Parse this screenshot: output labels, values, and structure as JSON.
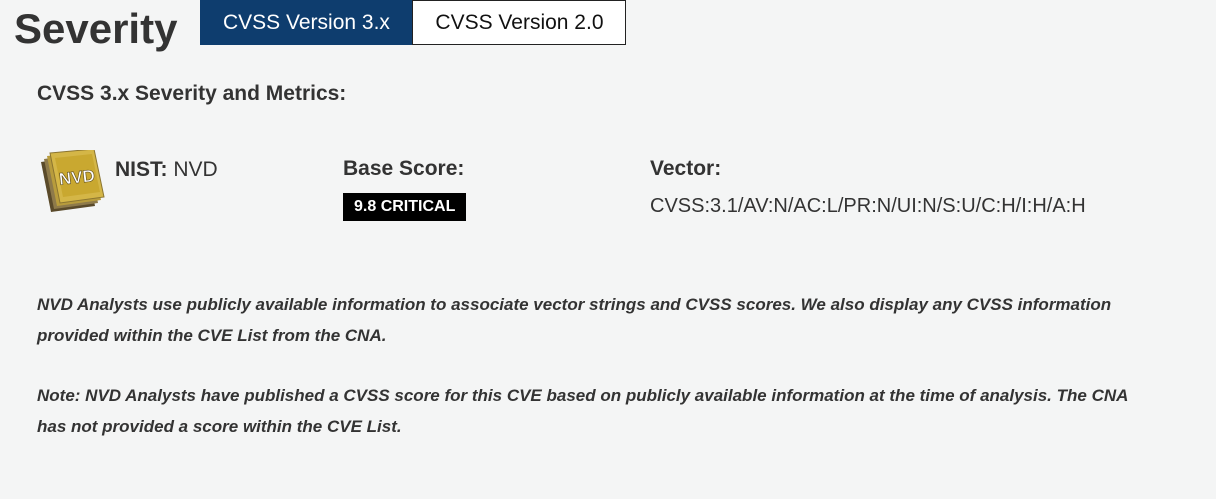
{
  "header": {
    "title": "Severity",
    "tabs": [
      {
        "label": "CVSS Version 3.x",
        "active": true
      },
      {
        "label": "CVSS Version 2.0",
        "active": false
      }
    ]
  },
  "section": {
    "title": "CVSS 3.x Severity and Metrics:"
  },
  "nist": {
    "logo_text": "NVD",
    "label": "NIST:",
    "value": "NVD"
  },
  "base_score": {
    "heading": "Base Score:",
    "badge": "9.8 CRITICAL"
  },
  "vector": {
    "heading": "Vector:",
    "value": "CVSS:3.1/AV:N/AC:L/PR:N/UI:N/S:U/C:H/I:H/A:H"
  },
  "notes": {
    "line1": "NVD Analysts use publicly available information to associate vector strings and CVSS scores. We also display any CVSS information provided within the CVE List from the CNA.",
    "line2": "Note: NVD Analysts have published a CVSS score for this CVE based on publicly available information at the time of analysis. The CNA has not provided a score within the CVE List."
  },
  "colors": {
    "active_tab": "#0e3d6e",
    "badge_bg": "#000000",
    "logo_gold": "#c9a830"
  }
}
